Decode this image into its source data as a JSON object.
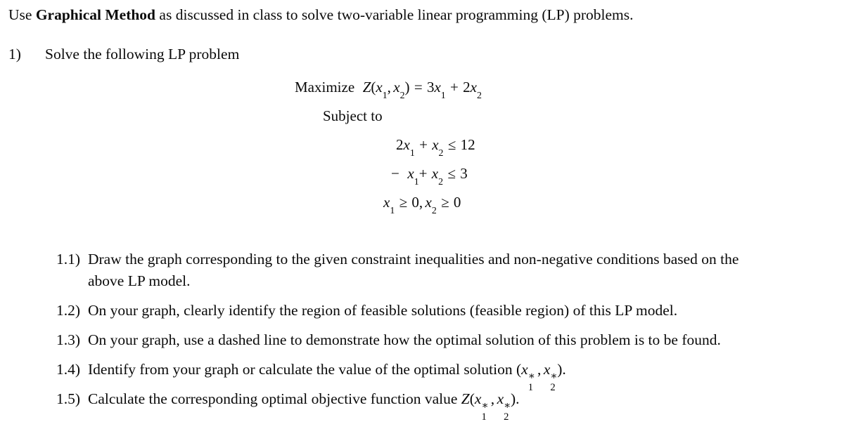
{
  "document": {
    "intro": {
      "prefix": "Use ",
      "bold": "Graphical Method",
      "suffix": " as discussed in class to solve two-variable linear programming (LP) problems."
    },
    "question": {
      "number": "1)",
      "text": "Solve the following LP problem"
    },
    "model": {
      "objective_label": "Maximize",
      "objective_z": "Z",
      "objective_var1": "x",
      "objective_var1_sub": "1",
      "objective_var2": "x",
      "objective_var2_sub": "2",
      "objective_equals": "=",
      "objective_coef1": "3",
      "objective_term1_var": "x",
      "objective_term1_sub": "1",
      "objective_plus": "+",
      "objective_coef2": "2",
      "objective_term2_var": "x",
      "objective_term2_sub": "2",
      "subject_to_label": "Subject to",
      "constraint1": {
        "coef1": "2",
        "var1": "x",
        "sub1": "1",
        "op1": "+",
        "var2": "x",
        "sub2": "2",
        "relation": "≤",
        "rhs": "12"
      },
      "constraint2": {
        "sign": "−",
        "var1": "x",
        "sub1": "1",
        "op1": "+",
        "var2": "x",
        "sub2": "2",
        "relation": "≤",
        "rhs": "3"
      },
      "constraint3": {
        "var1": "x",
        "sub1": "1",
        "relation1": "≥",
        "rhs1": "0",
        "comma": ",",
        "var2": "x",
        "sub2": "2",
        "relation2": "≥",
        "rhs2": "0"
      }
    },
    "subitems": [
      {
        "label": "1.1)",
        "text": "Draw the graph corresponding to the given constraint inequalities and non-negative conditions based on the",
        "continuation": "above LP model."
      },
      {
        "label": "1.2)",
        "text": "On your graph, clearly identify the region of feasible solutions (feasible region) of this LP model."
      },
      {
        "label": "1.3)",
        "text": "On your graph, use a dashed line to demonstrate how the optimal solution of this problem is to be found."
      },
      {
        "label": "1.4)",
        "text_before": "Identify from your graph or calculate the value of the optimal solution (",
        "var": "x",
        "star": "∗",
        "sub1": "1",
        "sub2": "2",
        "comma": ",",
        "text_after": ")."
      },
      {
        "label": "1.5)",
        "text_before": "Calculate the corresponding optimal objective function value ",
        "z": "Z",
        "paren_open": "(",
        "var": "x",
        "star": "∗",
        "sub1": "1",
        "sub2": "2",
        "comma": ",",
        "text_after": ")."
      }
    ]
  }
}
